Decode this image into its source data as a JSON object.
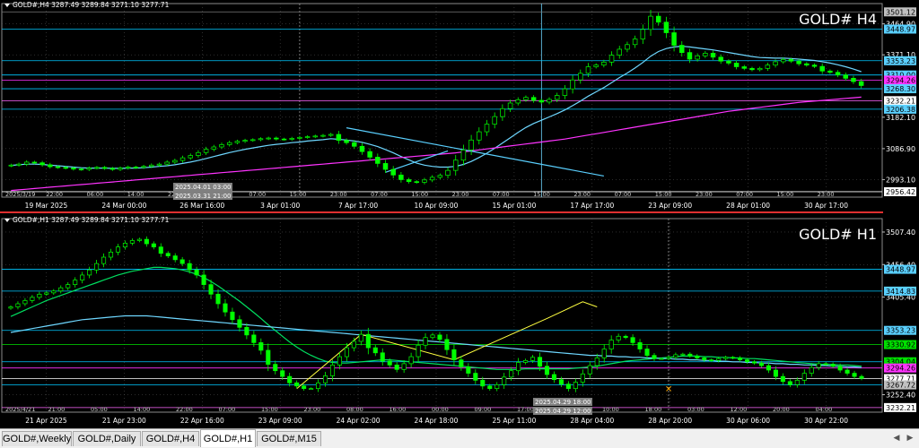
{
  "colors": {
    "background": "#000000",
    "grid": "#5a5a5a",
    "separator": "#e03030",
    "bull": "#00ff00",
    "bear": "#00ff00"
  },
  "tabs": [
    {
      "label": "GOLD#,Weekly",
      "active": false
    },
    {
      "label": "GOLD#,Daily",
      "active": false
    },
    {
      "label": "GOLD#,H4",
      "active": false
    },
    {
      "label": "GOLD#,H1",
      "active": true
    },
    {
      "label": "GOLD#,M15",
      "active": false
    }
  ],
  "tab_nav": {
    "left_icon": "triangle-left-icon",
    "right_icon": "triangle-right-icon"
  },
  "chart_data": [
    {
      "type": "candlestick",
      "symbol_label": "GOLD# H4",
      "info_line": "GOLD#,H4 3287.49 3289.84 3271.10 3277.71",
      "ylim": [
        2940,
        3510
      ],
      "y_ticks": [
        3464.9,
        3371.1,
        3182.1,
        3086.9,
        2993.1
      ],
      "x_labels": [
        "19 Mar 2025",
        "24 Mar 00:00",
        "26 Mar 16:00",
        "3 Apr 01:00",
        "7 Apr 17:00",
        "10 Apr 09:00",
        "15 Apr 01:00",
        "17 Apr 17:00",
        "23 Apr 09:00",
        "28 Apr 01:00",
        "30 Apr 17:00"
      ],
      "x_minor_labels": [
        "2025/3/19",
        "22:00",
        "06:00",
        "14:00",
        "22:00",
        "06:00",
        "07:00",
        "15:00",
        "23:00",
        "07:00",
        "15:00",
        "23:00",
        "07:00",
        "15:00",
        "23:00",
        "07:00",
        "15:00",
        "23:00",
        "07:00",
        "15:00",
        "23:00"
      ],
      "crosshair_time_labels": [
        "2025.04.01 03:00",
        "2025.03.31 21:00"
      ],
      "closes": [
        3037,
        3040,
        3046,
        3044,
        3038,
        3032,
        3030,
        3028,
        3025,
        3024,
        3028,
        3030,
        3027,
        3024,
        3028,
        3031,
        3030,
        3033,
        3037,
        3040,
        3046,
        3051,
        3059,
        3066,
        3075,
        3085,
        3092,
        3099,
        3105,
        3109,
        3112,
        3114,
        3117,
        3119,
        3116,
        3115,
        3118,
        3121,
        3123,
        3125,
        3127,
        3130,
        3112,
        3105,
        3094,
        3078,
        3061,
        3042,
        3024,
        3007,
        2993,
        2987,
        2985,
        2992,
        3000,
        3006,
        3021,
        3052,
        3083,
        3113,
        3138,
        3161,
        3184,
        3208,
        3225,
        3235,
        3242,
        3233,
        3228,
        3236,
        3248,
        3268,
        3295,
        3315,
        3335,
        3340,
        3349,
        3370,
        3388,
        3402,
        3419,
        3448,
        3488,
        3470,
        3438,
        3400,
        3378,
        3358,
        3368,
        3376,
        3364,
        3352,
        3346,
        3335,
        3330,
        3326,
        3330,
        3340,
        3350,
        3357,
        3352,
        3344,
        3340,
        3336,
        3322,
        3318,
        3310,
        3300,
        3290,
        3278
      ],
      "overlays": [
        {
          "name": "",
          "color": "#6ed7ff",
          "values": [
            3036,
            3038,
            3040,
            3040,
            3039,
            3037,
            3035,
            3033,
            3031,
            3029,
            3028,
            3028,
            3028,
            3027,
            3027,
            3028,
            3028,
            3029,
            3031,
            3033,
            3035,
            3038,
            3042,
            3046,
            3051,
            3057,
            3063,
            3069,
            3075,
            3080,
            3085,
            3089,
            3093,
            3097,
            3100,
            3102,
            3105,
            3107,
            3110,
            3112,
            3114,
            3117,
            3115,
            3113,
            3110,
            3106,
            3100,
            3093,
            3084,
            3074,
            3063,
            3053,
            3043,
            3037,
            3033,
            3031,
            3031,
            3033,
            3039,
            3048,
            3060,
            3073,
            3088,
            3104,
            3120,
            3136,
            3151,
            3163,
            3173,
            3183,
            3193,
            3204,
            3217,
            3231,
            3246,
            3259,
            3272,
            3287,
            3302,
            3316,
            3331,
            3348,
            3367,
            3381,
            3390,
            3395,
            3397,
            3395,
            3392,
            3389,
            3386,
            3382,
            3378,
            3374,
            3370,
            3366,
            3363,
            3362,
            3361,
            3361,
            3360,
            3358,
            3356,
            3354,
            3350,
            3346,
            3341,
            3335,
            3328,
            3320
          ]
        },
        {
          "name": "",
          "color": "#ff33ff",
          "values": [
            2960,
            2962,
            2964,
            2966,
            2968,
            2970,
            2972,
            2974,
            2976,
            2978,
            2980,
            2982,
            2984,
            2986,
            2988,
            2990,
            2992,
            2994,
            2996,
            2998,
            3000,
            3002,
            3004,
            3006,
            3008,
            3010,
            3012,
            3014,
            3016,
            3018,
            3020,
            3022,
            3024,
            3026,
            3028,
            3030,
            3032,
            3034,
            3036,
            3038,
            3040,
            3042,
            3044,
            3046,
            3048,
            3050,
            3052,
            3054,
            3056,
            3058,
            3060,
            3062,
            3064,
            3066,
            3068,
            3070,
            3072,
            3074,
            3077,
            3080,
            3083,
            3086,
            3089,
            3092,
            3095,
            3098,
            3101,
            3104,
            3107,
            3110,
            3113,
            3116,
            3120,
            3124,
            3128,
            3132,
            3136,
            3140,
            3144,
            3148,
            3152,
            3156,
            3160,
            3164,
            3168,
            3172,
            3176,
            3180,
            3184,
            3188,
            3192,
            3196,
            3200,
            3203,
            3206,
            3209,
            3212,
            3215,
            3218,
            3221,
            3224,
            3227,
            3229,
            3231,
            3233,
            3235,
            3237,
            3239,
            3241,
            3243
          ]
        }
      ],
      "trendlines": [
        {
          "name": "",
          "color": "#5ad0ff",
          "points": [
            [
              43,
              3150
            ],
            [
              76,
              3004
            ]
          ]
        },
        {
          "name": "",
          "color": "#5ad0ff",
          "points": [
            [
              48,
              3015
            ],
            [
              56,
              3080
            ]
          ]
        }
      ],
      "hlines": [
        {
          "value": 3501.12,
          "label": "3501.12",
          "color": "#7a7a7a",
          "label_bg": "#c0c0c0"
        },
        {
          "value": 3448.97,
          "label": "3448.97",
          "color": "#00c8ff",
          "label_bg": "#5ad0ff"
        },
        {
          "value": 3353.23,
          "label": "3353.23",
          "color": "#00c8ff",
          "label_bg": "#5ad0ff"
        },
        {
          "value": 3310.0,
          "label": "3310.00",
          "color": "#00c8ff",
          "label_bg": "#5ad0ff"
        },
        {
          "value": 3294.26,
          "label": "3294.26",
          "color": "#ff33ff",
          "label_bg": "#ff33ff"
        },
        {
          "value": 3268.3,
          "label": "3268.30",
          "color": "#00c8ff",
          "label_bg": "#5ad0ff"
        },
        {
          "value": 3232.21,
          "label": "3232.21",
          "color": "#ff66ff",
          "label_bg": "#ffffff"
        },
        {
          "value": 3206.38,
          "label": "3206.38",
          "color": "#00c8ff",
          "label_bg": "#5ad0ff"
        },
        {
          "value": 2956.42,
          "label": "2956.42",
          "color": "#ffffff",
          "label_bg": "#ffffff"
        }
      ],
      "vlines": [
        {
          "index": 37,
          "color": "#9a9a9a",
          "dash": true
        },
        {
          "index": 68,
          "color": "#6ed7ff",
          "dash": false
        }
      ]
    },
    {
      "type": "candlestick",
      "symbol_label": "GOLD# H1",
      "info_line": "GOLD#,H1 3287.49 3289.84 3271.10 3277.71",
      "ylim": [
        3225,
        3520
      ],
      "y_ticks": [
        3507.4,
        3456.4,
        3405.4,
        3252.4
      ],
      "x_labels": [
        "21 Apr 2025",
        "21 Apr 23:00",
        "22 Apr 16:00",
        "23 Apr 09:00",
        "24 Apr 02:00",
        "24 Apr 18:00",
        "25 Apr 11:00",
        "28 Apr 04:00",
        "28 Apr 20:00",
        "30 Apr 06:00",
        "30 Apr 22:00"
      ],
      "x_minor_labels": [
        "2025/4/21",
        "21:00",
        "05:00",
        "14:00",
        "22:00",
        "07:00",
        "15:00",
        "23:00",
        "08:00",
        "16:00",
        "00:00",
        "09:00",
        "17:00",
        "01:00",
        "10:00",
        "18:00",
        "03:00",
        "12:00",
        "20:00",
        "04:00"
      ],
      "crosshair_time_labels": [
        "2025.04.29 18:00",
        "2025.04.29 12:00"
      ],
      "closes": [
        3390,
        3395,
        3400,
        3405,
        3410,
        3412,
        3415,
        3420,
        3425,
        3432,
        3440,
        3448,
        3458,
        3468,
        3476,
        3484,
        3490,
        3494,
        3496,
        3489,
        3484,
        3474,
        3470,
        3464,
        3458,
        3448,
        3440,
        3425,
        3410,
        3395,
        3382,
        3370,
        3358,
        3346,
        3334,
        3322,
        3300,
        3290,
        3281,
        3271,
        3266,
        3262,
        3262,
        3271,
        3282,
        3299,
        3312,
        3326,
        3336,
        3347,
        3326,
        3318,
        3305,
        3299,
        3292,
        3301,
        3312,
        3330,
        3342,
        3346,
        3339,
        3323,
        3307,
        3296,
        3286,
        3275,
        3266,
        3262,
        3268,
        3280,
        3290,
        3303,
        3306,
        3311,
        3297,
        3284,
        3276,
        3269,
        3262,
        3272,
        3285,
        3298,
        3310,
        3324,
        3338,
        3344,
        3342,
        3334,
        3324,
        3314,
        3309,
        3309,
        3311,
        3315,
        3316,
        3313,
        3310,
        3307,
        3306,
        3309,
        3311,
        3310,
        3307,
        3304,
        3302,
        3298,
        3291,
        3281,
        3273,
        3268,
        3275,
        3286,
        3295,
        3301,
        3300,
        3297,
        3291,
        3286,
        3281,
        3278
      ],
      "overlays": [
        {
          "name": "",
          "color": "#00e060",
          "values": [
            3375,
            3380,
            3385,
            3390,
            3395,
            3400,
            3404,
            3408,
            3412,
            3416,
            3420,
            3424,
            3428,
            3432,
            3436,
            3440,
            3443,
            3446,
            3448,
            3450,
            3452,
            3452,
            3451,
            3450,
            3448,
            3445,
            3441,
            3436,
            3430,
            3423,
            3415,
            3407,
            3399,
            3390,
            3381,
            3372,
            3362,
            3353,
            3344,
            3335,
            3327,
            3320,
            3314,
            3309,
            3305,
            3303,
            3302,
            3302,
            3303,
            3304,
            3305,
            3306,
            3307,
            3307,
            3306,
            3305,
            3304,
            3303,
            3302,
            3301,
            3300,
            3299,
            3298,
            3297,
            3296,
            3295,
            3294,
            3293,
            3292,
            3292,
            3292,
            3292,
            3293,
            3293,
            3293,
            3293,
            3293,
            3293,
            3293,
            3294,
            3295,
            3296,
            3297,
            3299,
            3301,
            3303,
            3305,
            3306,
            3307,
            3308,
            3309,
            3310,
            3311,
            3312,
            3313,
            3313,
            3313,
            3312,
            3312,
            3311,
            3311,
            3310,
            3310,
            3309,
            3309,
            3308,
            3307,
            3306,
            3305,
            3304,
            3303,
            3302,
            3301,
            3300,
            3300,
            3300,
            3299,
            3299,
            3298,
            3297
          ]
        },
        {
          "name": "",
          "color": "#6ed7ff",
          "values": [
            3350,
            3352,
            3354,
            3356,
            3358,
            3360,
            3362,
            3364,
            3366,
            3368,
            3370,
            3371,
            3372,
            3373,
            3374,
            3375,
            3376,
            3376,
            3376,
            3376,
            3375,
            3374,
            3373,
            3372,
            3371,
            3370,
            3369,
            3368,
            3367,
            3366,
            3365,
            3364,
            3363,
            3362,
            3361,
            3360,
            3359,
            3358,
            3357,
            3356,
            3355,
            3354,
            3353,
            3352,
            3351,
            3350,
            3349,
            3348,
            3347,
            3346,
            3345,
            3344,
            3343,
            3342,
            3341,
            3340,
            3339,
            3338,
            3337,
            3336,
            3335,
            3334,
            3333,
            3332,
            3331,
            3330,
            3329,
            3328,
            3327,
            3326,
            3325,
            3324,
            3323,
            3322,
            3321,
            3320,
            3319,
            3318,
            3317,
            3316,
            3315,
            3314,
            3314,
            3313,
            3313,
            3312,
            3312,
            3311,
            3311,
            3310,
            3310,
            3309,
            3309,
            3308,
            3308,
            3307,
            3307,
            3306,
            3306,
            3305,
            3305,
            3304,
            3304,
            3303,
            3303,
            3302,
            3302,
            3301,
            3301,
            3300,
            3300,
            3299,
            3299,
            3298,
            3298,
            3297,
            3297,
            3296,
            3296,
            3295
          ]
        }
      ],
      "zigzag": {
        "color": "#ffff40",
        "points": [
          [
            40,
            3262
          ],
          [
            49,
            3347
          ],
          [
            62,
            3307
          ],
          [
            75,
            3372
          ],
          [
            80,
            3398
          ],
          [
            82,
            3390
          ]
        ]
      },
      "hlines": [
        {
          "value": 3448.97,
          "label": "3448.97",
          "color": "#00c8ff",
          "label_bg": "#5ad0ff"
        },
        {
          "value": 3414.83,
          "label": "3414.83",
          "color": "#00c8ff",
          "label_bg": "#5ad0ff"
        },
        {
          "value": 3353.23,
          "label": "3353.23",
          "color": "#00c8ff",
          "label_bg": "#5ad0ff"
        },
        {
          "value": 3330.92,
          "label": "3330.92",
          "color": "#00e000",
          "label_bg": "#00e000"
        },
        {
          "value": 3304.04,
          "label": "3304.04",
          "color": "#00c8ff",
          "label_bg": "#00e000"
        },
        {
          "value": 3294.26,
          "label": "3294.26",
          "color": "#ff33ff",
          "label_bg": "#ff33ff"
        },
        {
          "value": 3277.71,
          "label": "3277.71",
          "color": "#ffffff",
          "label_bg": "#ffffff"
        },
        {
          "value": 3267.72,
          "label": "3267.72",
          "color": "#00c8ff",
          "label_bg": "#c0c0c0"
        },
        {
          "value": 3232.21,
          "label": "3232.21",
          "color": "#ff66ff",
          "label_bg": "#ffffff"
        }
      ],
      "vlines": [
        {
          "index": 92,
          "color": "#9a9a9a",
          "dash": true
        }
      ],
      "marker": {
        "index": 92,
        "value": 3262,
        "color": "#ffaa00",
        "glyph": "✕"
      }
    }
  ]
}
